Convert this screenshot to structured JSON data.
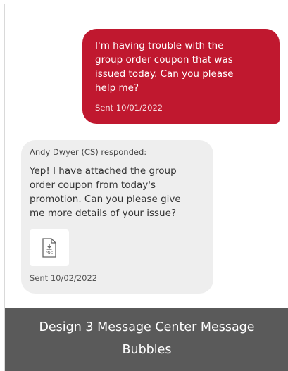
{
  "conversation": {
    "sent_message": {
      "text": "I'm having trouble with the\ngroup order coupon that was\nissued today. Can you please\nhelp me?",
      "sent_label": "Sent 10/01/2022"
    },
    "received_message": {
      "responder": "Andy Dwyer (CS) responded:",
      "text": "Yep! I have attached the group\norder coupon from today's\npromotion. Can you please give\nme more details of your issue?",
      "attachment": {
        "icon": "png-file-icon",
        "type_label": "PNG"
      },
      "sent_label": "Sent 10/02/2022"
    }
  },
  "caption": {
    "text": "Design 3 Message Center Message Bubbles"
  },
  "colors": {
    "sent_bubble": "#c0182f",
    "received_bubble": "#eeeeee",
    "caption_bar": "#5a5a5a"
  }
}
